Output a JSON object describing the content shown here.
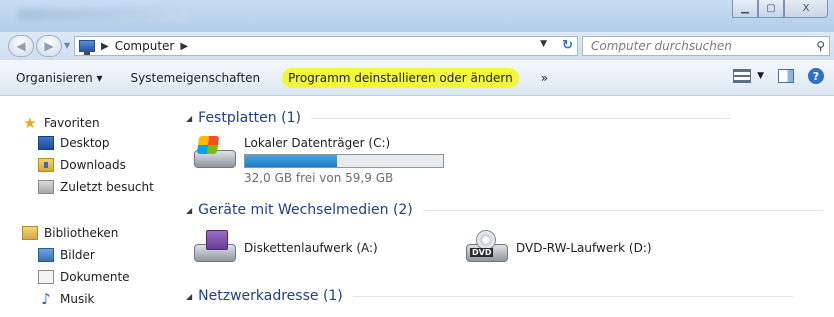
{
  "titlebar": {
    "buttons": [
      "minimize",
      "maximize",
      "close"
    ],
    "close_glyph": "X"
  },
  "address": {
    "crumbs": [
      "Computer"
    ]
  },
  "search": {
    "placeholder": "Computer durchsuchen"
  },
  "toolbar": {
    "organize": "Organisieren ▾",
    "system_properties": "Systemeigenschaften",
    "uninstall": "Programm deinstallieren oder ändern",
    "more": "»",
    "highlight_color": "#f3f73a"
  },
  "sidebar": {
    "favorites": "Favoriten",
    "fav_items": [
      "Desktop",
      "Downloads",
      "Zuletzt besucht"
    ],
    "libraries": "Bibliotheken",
    "lib_items": [
      "Bilder",
      "Dokumente",
      "Musik"
    ]
  },
  "sections": {
    "hdd": {
      "title": "Festplatten (1)"
    },
    "removable": {
      "title": "Geräte mit Wechselmedien (2)"
    },
    "network": {
      "title": "Netzwerkadresse (1)"
    }
  },
  "drives": {
    "c": {
      "name": "Lokaler Datenträger (C:)",
      "free_text": "32,0 GB frei von 59,9 GB",
      "used_fraction": 0.466
    },
    "a": {
      "name": "Diskettenlaufwerk (A:)"
    },
    "d": {
      "name": "DVD-RW-Laufwerk (D:)",
      "badge": "DVD"
    }
  }
}
